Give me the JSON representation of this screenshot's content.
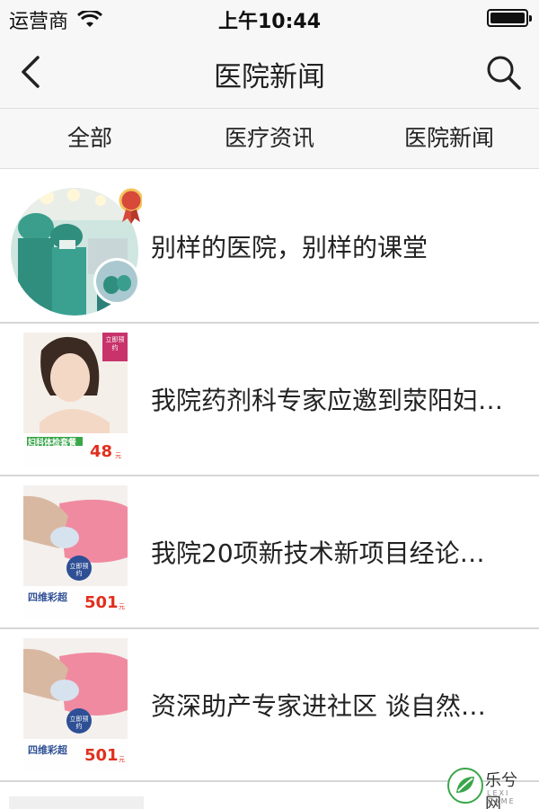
{
  "status_bar": {
    "carrier": "运营商",
    "time": "上午10:44",
    "battery_level": 1.0
  },
  "nav": {
    "title": "医院新闻"
  },
  "tabs": [
    {
      "label": "全部"
    },
    {
      "label": "医疗资讯"
    },
    {
      "label": "医院新闻"
    }
  ],
  "news": [
    {
      "title": "别样的医院，别样的课堂"
    },
    {
      "title": "我院药剂科专家应邀到荥阳妇…",
      "thumb": {
        "tag": "立即预约",
        "caption": "妇科体检套餐",
        "price": "48",
        "price_unit": "元"
      }
    },
    {
      "title": "我院20项新技术新项目经论…",
      "thumb": {
        "tag": "立即预约",
        "caption": "四维彩超",
        "price": "501",
        "price_unit": "元"
      }
    },
    {
      "title": "资深助产专家进社区 谈自然…",
      "thumb": {
        "tag": "立即预约",
        "caption": "四维彩超",
        "price": "501",
        "price_unit": "元"
      }
    }
  ],
  "watermark": {
    "text": "乐兮网",
    "sub": "LEXI GAME"
  },
  "colors": {
    "bar_bg": "#f7f7f7",
    "divider": "#d6d6d6",
    "accent_green": "#3aa64a",
    "price_red": "#e0301e",
    "tag_pink": "#c8336b"
  },
  "icons": [
    "wifi-icon",
    "battery-icon",
    "back-chevron-icon",
    "search-icon"
  ]
}
